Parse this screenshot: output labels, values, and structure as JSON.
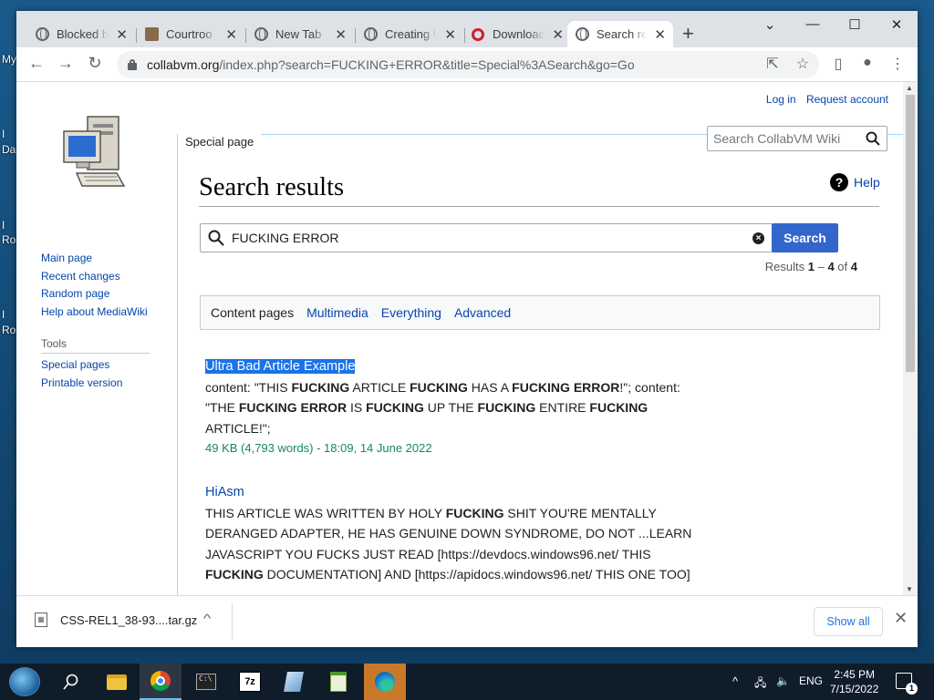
{
  "desktop": {
    "labels": [
      "My",
      "I",
      "Da",
      "I",
      "I",
      "Ro",
      "I",
      "Ro"
    ]
  },
  "browser": {
    "tabs": [
      {
        "title": "Blocked b",
        "icon": "globe-icon",
        "active": false
      },
      {
        "title": "Courtroo",
        "icon": "image-favicon",
        "active": false
      },
      {
        "title": "New Tab",
        "icon": "chrome-icon",
        "active": false
      },
      {
        "title": "Creating U",
        "icon": "globe-icon",
        "active": false
      },
      {
        "title": "Download",
        "icon": "opera-icon",
        "active": false
      },
      {
        "title": "Search re",
        "icon": "globe-icon",
        "active": true
      }
    ],
    "new_tab_label": "+",
    "window_controls": {
      "minimize": "—",
      "maximize": "☐",
      "close": "✕",
      "tab_list": "⌄"
    },
    "url_host": "collabvm.org",
    "url_path": "/index.php?search=FUCKING+ERROR&title=Special%3ASearch&go=Go"
  },
  "wiki": {
    "personal": {
      "login": "Log in",
      "request": "Request account"
    },
    "page_tab": "Special page",
    "search_placeholder": "Search CollabVM Wiki",
    "nav": [
      "Main page",
      "Recent changes",
      "Random page",
      "Help about MediaWiki"
    ],
    "tools_heading": "Tools",
    "tools": [
      "Special pages",
      "Printable version"
    ],
    "title": "Search results",
    "help": "Help",
    "query": "FUCKING ERROR",
    "search_button": "Search",
    "results_prefix": "Results ",
    "results_from": "1",
    "results_dash": " – ",
    "results_to": "4",
    "results_of": " of ",
    "results_total": "4",
    "filters": [
      "Content pages",
      "Multimedia",
      "Everything",
      "Advanced"
    ],
    "results": [
      {
        "title": "Ultra Bad Article Example",
        "snippet": [
          {
            "t": "content: \"THIS ",
            "b": false
          },
          {
            "t": "FUCKING",
            "b": true
          },
          {
            "t": " ARTICLE ",
            "b": false
          },
          {
            "t": "FUCKING",
            "b": true
          },
          {
            "t": " HAS A ",
            "b": false
          },
          {
            "t": "FUCKING ERROR",
            "b": true
          },
          {
            "t": "!\"; content: \"THE ",
            "b": false
          },
          {
            "t": "FUCKING ERROR",
            "b": true
          },
          {
            "t": " IS ",
            "b": false
          },
          {
            "t": "FUCKING",
            "b": true
          },
          {
            "t": " UP THE ",
            "b": false
          },
          {
            "t": "FUCKING",
            "b": true
          },
          {
            "t": " ENTIRE ",
            "b": false
          },
          {
            "t": "FUCKING",
            "b": true
          },
          {
            "t": " ARTICLE!\";",
            "b": false
          }
        ],
        "meta": "49 KB (4,793 words) - 18:09, 14 June 2022"
      },
      {
        "title": "HiAsm",
        "snippet": [
          {
            "t": "THIS ARTICLE WAS WRITTEN BY HOLY ",
            "b": false
          },
          {
            "t": "FUCKING",
            "b": true
          },
          {
            "t": " SHIT YOU'RE MENTALLY DERANGED ADAPTER, HE HAS GENUINE DOWN SYNDROME, DO NOT ...LEARN JAVASCRIPT YOU FUCKS JUST READ [https://devdocs.windows96.net/ THIS ",
            "b": false
          },
          {
            "t": "FUCKING",
            "b": true
          },
          {
            "t": " DOCUMENTATION] AND [https://apidocs.windows96.net/ THIS ONE TOO]",
            "b": false
          }
        ]
      }
    ]
  },
  "downloads": {
    "file": "CSS-REL1_38-93....tar.gz",
    "show_all": "Show all",
    "close": "✕"
  },
  "taskbar": {
    "apps": [
      "search-icon",
      "file-explorer-icon",
      "chrome-icon",
      "terminal-icon",
      "7zip-icon",
      "app-icon",
      "notepad-icon",
      "edge-icon"
    ],
    "lang": "ENG",
    "time": "2:45 PM",
    "date": "7/15/2022",
    "notifications": "1"
  }
}
